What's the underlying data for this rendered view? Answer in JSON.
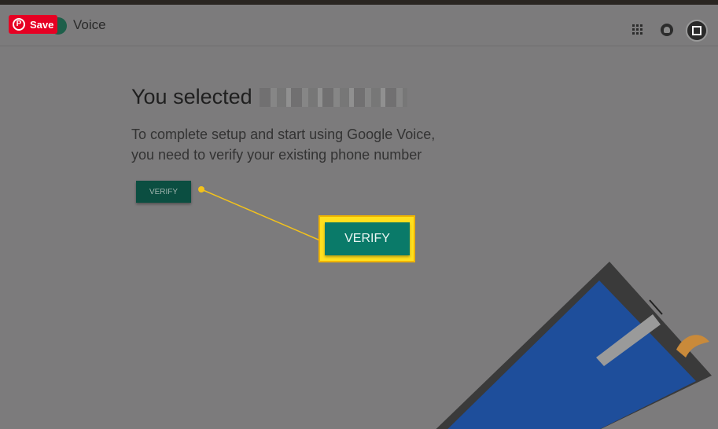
{
  "app": {
    "title": "Voice",
    "save_label": "Save"
  },
  "header": {
    "icons": [
      "apps-grid-icon",
      "notifications-bell-icon",
      "avatar-icon"
    ]
  },
  "main": {
    "heading": "You selected",
    "description_line1": "To complete setup and start using Google Voice,",
    "description_line2": "you need to verify your existing phone number",
    "verify_button_label": "VERIFY",
    "callout_verify_label": "VERIFY"
  },
  "colors": {
    "overlay_gray": "#7c7b7c",
    "verify_green": "#0a7a69",
    "callout_yellow": "#ffe01e",
    "pinterest_red": "#e60023",
    "phone_blue": "#1e4e9b"
  }
}
